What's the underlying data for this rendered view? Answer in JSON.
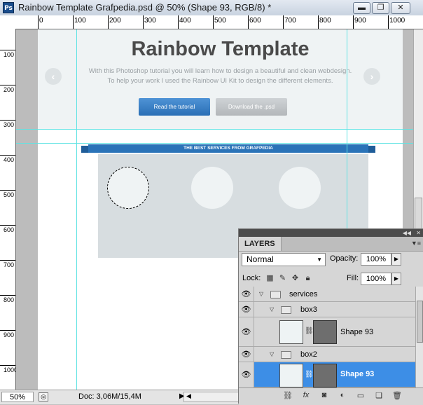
{
  "window": {
    "title": "Rainbow Template Grafpedia.psd @ 50% (Shape 93, RGB/8) *",
    "app_icon": "Ps",
    "minimize": "▬",
    "restore": "❐",
    "close": "✕"
  },
  "ruler": {
    "top_labels": [
      "0",
      "100",
      "200",
      "300",
      "400",
      "500",
      "600",
      "700",
      "800",
      "900",
      "1000"
    ],
    "left_labels": [
      "100",
      "200",
      "300",
      "400",
      "500",
      "600",
      "700",
      "800",
      "900",
      "1000"
    ]
  },
  "canvas": {
    "hero_title": "Rainbow Template",
    "hero_sub_1": "With this Photoshop tutorial you will learn how to design a beautiful and clean webdesign.",
    "hero_sub_2": "To help your work I used the Rainbow UI Kit to design the different elements.",
    "btn_primary": "Read the tutorial",
    "btn_secondary": "Download the .psd",
    "ribbon": "THE BEST SERVICES FROM GRAFPEDIA",
    "arrow_left": "‹",
    "arrow_right": "›",
    "colors": {
      "hero_bg": "#eff3f4",
      "services_bg": "#d7dde0",
      "ribbon": "#2a73b8",
      "guide": "#5fe3e3"
    }
  },
  "status": {
    "zoom": "50%",
    "doc": "Doc: 3,06M/15,4M",
    "arrow": "▶",
    "nav_arrow": "◀"
  },
  "layers": {
    "tab": "LAYERS",
    "blend_mode": "Normal",
    "opacity_label": "Opacity:",
    "opacity": "100%",
    "lock_label": "Lock:",
    "fill_label": "Fill:",
    "fill": "100%",
    "items": [
      {
        "name": "services",
        "type": "group"
      },
      {
        "name": "box3",
        "type": "group"
      },
      {
        "name": "Shape 93",
        "type": "shape"
      },
      {
        "name": "box2",
        "type": "group"
      },
      {
        "name": "Shape 93",
        "type": "shape",
        "selected": true
      }
    ],
    "footer_icons": [
      "link-icon",
      "fx-icon",
      "mask-icon",
      "adjustment-icon",
      "group-icon",
      "new-layer-icon",
      "trash-icon"
    ],
    "fx": "fx"
  }
}
